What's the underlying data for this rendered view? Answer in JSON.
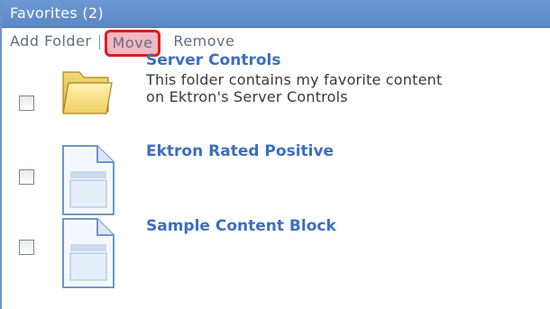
{
  "panel": {
    "title": "Favorites (2)"
  },
  "toolbar": {
    "add_folder_label": "Add Folder",
    "move_label": "Move",
    "remove_label": "Remove"
  },
  "items": [
    {
      "title": "Server Controls",
      "description_line1": "This folder contains my favorite content",
      "description_line2": "on Ektron's Server Controls",
      "icon": "folder-icon"
    },
    {
      "title": "Ektron Rated Positive",
      "icon": "document-icon"
    },
    {
      "title": "Sample Content Block",
      "icon": "document-icon"
    }
  ],
  "colors": {
    "titlebar": "#5b87c5",
    "link": "#3c6ec0",
    "highlight_border": "#e6191f",
    "highlight_fill": "#f2b8c4"
  }
}
